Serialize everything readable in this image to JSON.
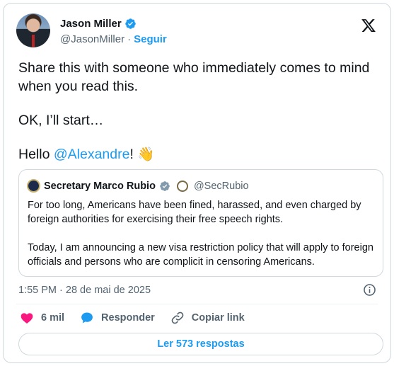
{
  "author": {
    "name": "Jason Miller",
    "handle": "@JasonMiller",
    "separator": "·",
    "follow_label": "Seguir"
  },
  "tweet": {
    "line1": "Share this with someone who immediately comes to mind when you read this.",
    "line2": "OK, I’ll start…",
    "line3_prefix": "Hello ",
    "mention": "@Alexandre",
    "line3_suffix": "! ",
    "emoji": "👋"
  },
  "quoted": {
    "name": "Secretary Marco Rubio",
    "handle": "@SecRubio",
    "para1": "For too long, Americans have been fined, harassed, and even charged by foreign authorities for exercising their free speech rights.",
    "para2": "Today, I am announcing a new visa restriction policy that will apply to foreign officials and persons who are complicit in censoring Americans."
  },
  "meta": {
    "timestamp": "1:55 PM · 28 de mai de 2025"
  },
  "actions": {
    "like_count": "6 mil",
    "reply_label": "Responder",
    "copy_label": "Copiar link"
  },
  "replies_button": "Ler 573 respostas",
  "colors": {
    "accent": "#1d9bf0",
    "like": "#f91880",
    "text": "#0f1419",
    "muted": "#536471",
    "border": "#cfd9de"
  },
  "icons": [
    "verified-badge-icon",
    "x-logo-icon",
    "government-seal-icon",
    "info-icon",
    "heart-icon",
    "reply-bubble-icon",
    "link-icon"
  ]
}
